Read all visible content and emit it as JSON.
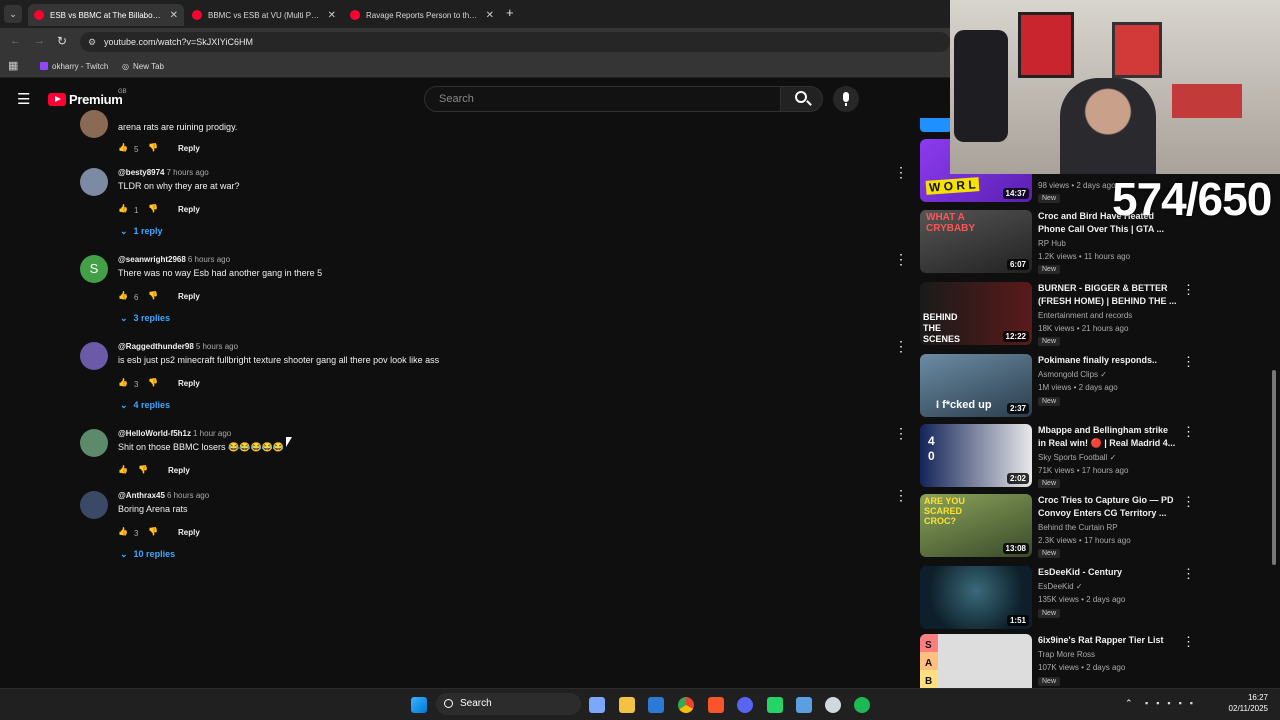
{
  "browser": {
    "tabs": [
      {
        "title": "ESB vs BBMC at The Billabong (",
        "active": true
      },
      {
        "title": "BBMC vs ESB at VU (Multi POV)",
        "active": false
      },
      {
        "title": "Ravage Reports Person to the A",
        "active": false
      }
    ],
    "new_tab": "+",
    "url": "youtube.com/watch?v=SkJXIYiC6HM",
    "bookmarks": [
      "okharry - Twitch",
      "New Tab"
    ]
  },
  "youtube": {
    "logo_text": "Premium",
    "region": "GB",
    "search_placeholder": "Search"
  },
  "comments": [
    {
      "handle": "",
      "time": "",
      "text": "arena rats are ruining prodigy.",
      "likes": "5",
      "reply": "Reply",
      "replies": "",
      "avatar_color": "#8a6a55"
    },
    {
      "handle": "@besty8974",
      "time": "7 hours ago",
      "text": "TLDR on why they are at war?",
      "likes": "1",
      "reply": "Reply",
      "replies": "1 reply",
      "avatar_color": "#7d8aa3"
    },
    {
      "handle": "@seanwright2968",
      "time": "6 hours ago",
      "text": "There was no way Esb had another gang in there 5",
      "likes": "6",
      "reply": "Reply",
      "replies": "3 replies",
      "avatar_color": "#43a047",
      "avatar_letter": "S"
    },
    {
      "handle": "@Raggedthunder98",
      "time": "5 hours ago",
      "text": "is esb just ps2 minecraft fullbright texture shooter gang all there pov look like ass",
      "likes": "3",
      "reply": "Reply",
      "replies": "4 replies",
      "avatar_color": "#6a5aa8"
    },
    {
      "handle": "@HelloWorld-f5h1z",
      "time": "1 hour ago",
      "text": "Shit on those BBMC losers 😂😂😂😂😂",
      "likes": "",
      "reply": "Reply",
      "replies": "",
      "avatar_color": "#5c8a6a"
    },
    {
      "handle": "@Anthrax45",
      "time": "6 hours ago",
      "text": "Boring Arena rats",
      "likes": "3",
      "reply": "Reply",
      "replies": "10 replies",
      "avatar_color": "#3a4a66"
    }
  ],
  "sidebar": [
    {
      "title": "",
      "channel": "",
      "views": "98 views",
      "age": "2 days ago",
      "badge": "New",
      "duration": "14:37",
      "thumb_color": "#7a2bd6",
      "thumb_text": "W O R L"
    },
    {
      "title": "Croc and Bird Have Heated Phone Call Over This | GTA ...",
      "channel": "RP Hub",
      "views": "1.2K views",
      "age": "11 hours ago",
      "badge": "New",
      "duration": "6:07",
      "thumb_color": "#3a3a3a",
      "thumb_text": "WHAT A CRYBABY"
    },
    {
      "title": "BURNER - BIGGER & BETTER (FRESH HOME) | BEHIND THE ...",
      "channel": "Entertainment and records",
      "views": "18K views",
      "age": "21 hours ago",
      "badge": "New",
      "duration": "12:22",
      "thumb_color": "#2a2222",
      "thumb_text": "BEHIND THE SCENES"
    },
    {
      "title": "Pokimane finally responds..",
      "channel": "Asmongold Clips",
      "views": "1M views",
      "age": "2 days ago",
      "badge": "New",
      "duration": "2:37",
      "thumb_color": "#3b5d78",
      "thumb_text": "I f*cked up"
    },
    {
      "title": "Mbappe and Bellingham strike in Real win! 🔴 | Real Madrid 4...",
      "channel": "Sky Sports Football",
      "views": "71K views",
      "age": "17 hours ago",
      "badge": "New",
      "duration": "2:02",
      "thumb_color": "#1a2a55",
      "thumb_text": "4 0"
    },
    {
      "title": "Croc Tries to Capture Gio — PD Convoy Enters CG Territory ...",
      "channel": "Behind the Curtain RP",
      "views": "2.3K views",
      "age": "17 hours ago",
      "badge": "New",
      "duration": "13:08",
      "thumb_color": "#5a7a3a",
      "thumb_text": "ARE YOU SCARED CROC?"
    },
    {
      "title": "EsDeeKid - Century",
      "channel": "EsDeeKid",
      "views": "135K views",
      "age": "2 days ago",
      "badge": "New",
      "duration": "1:51",
      "thumb_color": "#0d1f2a",
      "thumb_text": ""
    },
    {
      "title": "6ix9ine's Rat Rapper Tier List",
      "channel": "Trap More Ross",
      "views": "107K views",
      "age": "2 days ago",
      "badge": "New",
      "duration": "",
      "thumb_color": "#e8e8e8",
      "thumb_text": "S A B"
    }
  ],
  "overlay": {
    "counter": "574/650"
  },
  "taskbar": {
    "search": "Search",
    "time": "16:27",
    "date": "02/11/2025"
  },
  "colors": {
    "yt_red": "#ff0033",
    "link_blue": "#3ea6ff",
    "bg": "#0f0f0f"
  }
}
